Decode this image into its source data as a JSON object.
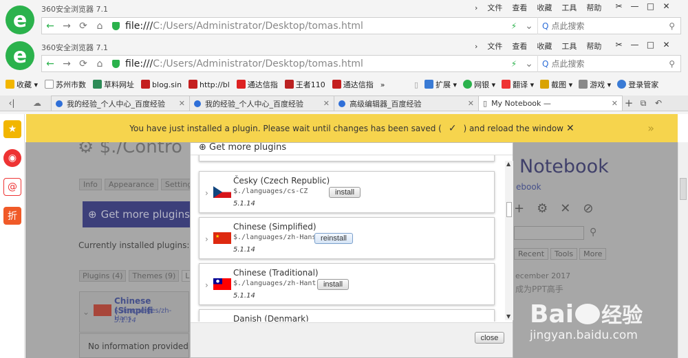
{
  "browser": {
    "app_title": "360安全浏览器 7.1",
    "menu": [
      "文件",
      "查看",
      "收藏",
      "工具",
      "帮助"
    ],
    "win_buttons": [
      "✂",
      "—",
      "□",
      "✕"
    ],
    "url_prefix": "file:///",
    "url_path": "C:/Users/Administrator/Desktop/tomas.html",
    "search_placeholder": "点此搜索",
    "bookmarks": [
      "收藏",
      "苏州市数",
      "草料网址",
      "blog.sin",
      "http://bl",
      "通达信指",
      "王者110",
      "通达信指",
      "»"
    ],
    "toolbar_right": [
      "扩展",
      "网银",
      "翻译",
      "截图",
      "游戏",
      "登录管家"
    ],
    "tabs": [
      {
        "label": "我的经验_个人中心_百度经验"
      },
      {
        "label": "我的经验_个人中心_百度经验"
      },
      {
        "label": "高级编辑器_百度经验"
      },
      {
        "label": "My Notebook —"
      }
    ]
  },
  "notification": {
    "text_before": "You have just installed a plugin. Please wait until changes has been saved (",
    "check": "✓",
    "text_after": ") and reload the window",
    "close": "✕",
    "more": "»"
  },
  "background_page": {
    "control_title": "$./Contro",
    "tabs": [
      "Info",
      "Appearance",
      "Settings"
    ],
    "get_more_button": "Get more plugins",
    "installed_label": "Currently installed plugins:",
    "plugin_tabs": [
      "Plugins (4)",
      "Themes (9)",
      "La"
    ],
    "installed_name": "Chinese (Simplifi",
    "installed_path": "$./languages/zh-Hans",
    "installed_version": "5.1.14",
    "no_info": "No information provided",
    "notebook_title": "Notebook",
    "notebook_sub": "ebook",
    "side_tabs": [
      "Recent",
      "Tools",
      "More"
    ],
    "date_text": "ecember 2017",
    "cn_text": "成为PPT高手",
    "watermark_brand": "Bai",
    "watermark_jy": "经验",
    "watermark_url": "jingyan.baidu.com"
  },
  "modal": {
    "header": "Get more plugins",
    "plugins": [
      {
        "name": "Česky (Czech Republic)",
        "path": "$./languages/cs-CZ",
        "version": "5.1.14",
        "action": "install"
      },
      {
        "name": "Chinese (Simplified)",
        "path": "$./languages/zh-Hans",
        "version": "5.1.14",
        "action": "reinstall"
      },
      {
        "name": "Chinese (Traditional)",
        "path": "$./languages/zh-Hant",
        "version": "5.1.14",
        "action": "install"
      },
      {
        "name": "Danish (Denmark)",
        "path": "",
        "version": "",
        "action": ""
      }
    ],
    "close_label": "close"
  }
}
